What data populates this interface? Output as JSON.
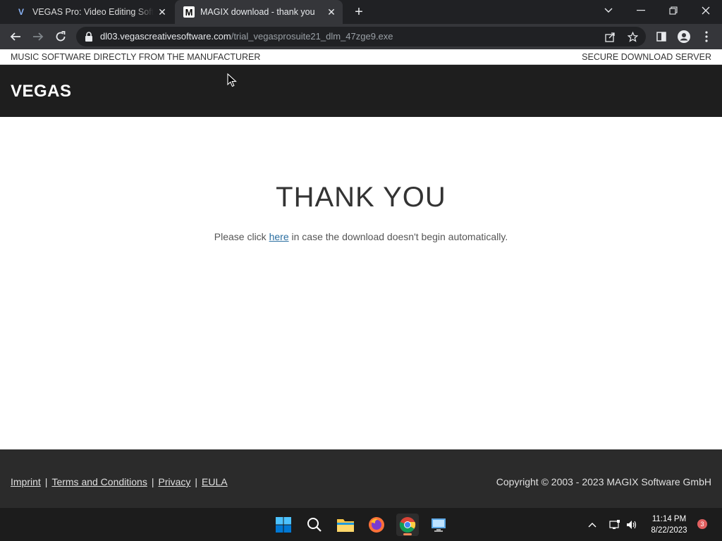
{
  "browser": {
    "tabs": [
      {
        "label": "VEGAS Pro: Video Editing Software",
        "favicon": "V",
        "active": false
      },
      {
        "label": "MAGIX download - thank you",
        "favicon": "M",
        "active": true
      }
    ],
    "url": {
      "domain": "dl03.vegascreativesoftware.com",
      "path": "/trial_vegasprosuite21_dlm_47zge9.exe"
    }
  },
  "page": {
    "topbar": {
      "left": "MUSIC SOFTWARE DIRECTLY FROM THE MANUFACTURER",
      "right": "SECURE DOWNLOAD SERVER"
    },
    "logo": "VEGAS",
    "heading": "THANK YOU",
    "message": {
      "before": "Please click ",
      "link": "here",
      "after": " in case the download doesn't begin automatically."
    },
    "footer": {
      "links": [
        "Imprint",
        "Terms and Conditions",
        "Privacy",
        "EULA"
      ],
      "separator": "|",
      "copyright": "Copyright © 2003 - 2023 MAGIX Software GmbH"
    }
  },
  "taskbar": {
    "time": "11:14 PM",
    "date": "8/22/2023",
    "notification_count": "3"
  },
  "colors": {
    "chrome_dark": "#202124",
    "chrome_toolbar": "#35363a",
    "header_bg": "#1e1e1e",
    "footer_bg": "#2b2b2b",
    "link": "#2a6ea0"
  }
}
